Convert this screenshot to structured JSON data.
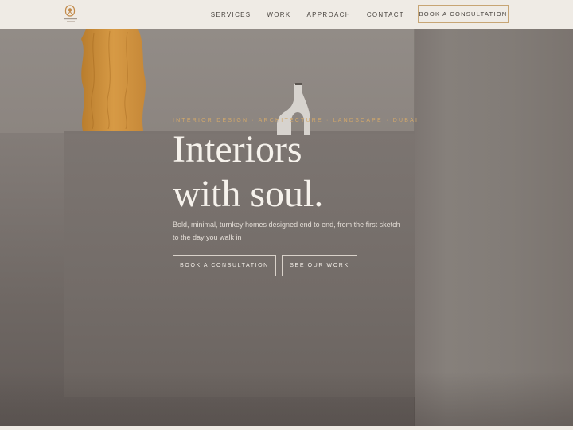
{
  "header": {
    "logo_icon": "brand-monogram-icon",
    "nav": [
      {
        "label": "SERVICES"
      },
      {
        "label": "WORK"
      },
      {
        "label": "APPROACH"
      },
      {
        "label": "CONTACT"
      }
    ],
    "cta_label": "BOOK A CONSULTATION"
  },
  "hero": {
    "tagline": "INTERIOR DESIGN  ·  ARCHITECTURE  ·  LANDSCAPE  ·  DUBAI",
    "headline_line1": "Interiors",
    "headline_line2": "with soul.",
    "subtext": "Bold, minimal, turnkey homes designed end to end, from the first sketch to the day you walk in",
    "primary_button": "BOOK A CONSULTATION",
    "secondary_button": "SEE OUR WORK"
  },
  "colors": {
    "accent": "#c7a574",
    "tagline": "#d2a86a",
    "header_bg": "#efebe5"
  }
}
